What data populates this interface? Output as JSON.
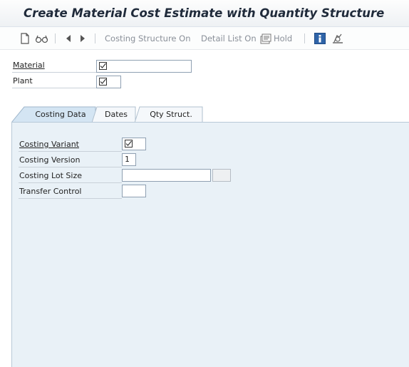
{
  "window": {
    "title": "Create Material Cost Estimate with Quantity Structure"
  },
  "toolbar": {
    "icons": [
      "new-document-icon",
      "glasses-icon",
      "arrow-left-icon",
      "arrow-right-icon",
      "hold-icon",
      "info-icon",
      "settings-icon"
    ],
    "costing_structure_label": "Costing Structure On",
    "detail_list_label": "Detail List On",
    "hold_label": "Hold"
  },
  "header_fields": {
    "material_label": "Material",
    "plant_label": "Plant"
  },
  "tabs": [
    {
      "label": "Costing Data",
      "active": true
    },
    {
      "label": "Dates",
      "active": false
    },
    {
      "label": "Qty Struct.",
      "active": false
    }
  ],
  "costing_data": {
    "costing_variant_label": "Costing Variant",
    "costing_version_label": "Costing Version",
    "costing_version_value": "1",
    "costing_lot_size_label": "Costing Lot Size",
    "transfer_control_label": "Transfer Control"
  },
  "colors": {
    "panel_bg": "#e9f1f7",
    "tab_active": "#d4e5f3",
    "title_text": "#1f2a3a"
  }
}
